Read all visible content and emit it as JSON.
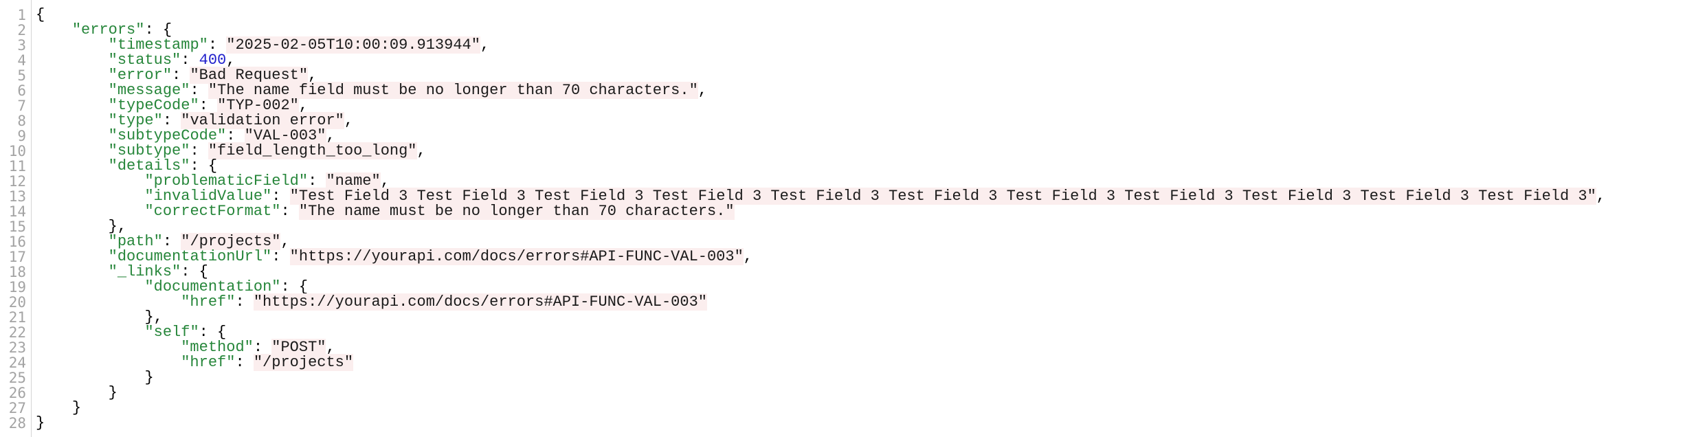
{
  "json_viewer": {
    "colors": {
      "key": "#26863a",
      "string_text": "#1a1a1a",
      "string_bg": "#fbeeee",
      "number": "#1f1fcc",
      "punct": "#000000",
      "line_number": "#a3a3a3"
    },
    "lines": [
      {
        "tokens": [
          {
            "t": "p",
            "v": "{"
          }
        ]
      },
      {
        "tokens": [
          {
            "t": "i",
            "v": "    "
          },
          {
            "t": "k",
            "v": "\"errors\""
          },
          {
            "t": "p",
            "v": ": {"
          }
        ]
      },
      {
        "tokens": [
          {
            "t": "i",
            "v": "        "
          },
          {
            "t": "k",
            "v": "\"timestamp\""
          },
          {
            "t": "p",
            "v": ": "
          },
          {
            "t": "s",
            "v": "\"2025-02-05T10:00:09.913944\""
          },
          {
            "t": "p",
            "v": ","
          }
        ]
      },
      {
        "tokens": [
          {
            "t": "i",
            "v": "        "
          },
          {
            "t": "k",
            "v": "\"status\""
          },
          {
            "t": "p",
            "v": ": "
          },
          {
            "t": "n",
            "v": "400"
          },
          {
            "t": "p",
            "v": ","
          }
        ]
      },
      {
        "tokens": [
          {
            "t": "i",
            "v": "        "
          },
          {
            "t": "k",
            "v": "\"error\""
          },
          {
            "t": "p",
            "v": ": "
          },
          {
            "t": "s",
            "v": "\"Bad Request\""
          },
          {
            "t": "p",
            "v": ","
          }
        ]
      },
      {
        "tokens": [
          {
            "t": "i",
            "v": "        "
          },
          {
            "t": "k",
            "v": "\"message\""
          },
          {
            "t": "p",
            "v": ": "
          },
          {
            "t": "s",
            "v": "\"The name field must be no longer than 70 characters.\""
          },
          {
            "t": "p",
            "v": ","
          }
        ]
      },
      {
        "tokens": [
          {
            "t": "i",
            "v": "        "
          },
          {
            "t": "k",
            "v": "\"typeCode\""
          },
          {
            "t": "p",
            "v": ": "
          },
          {
            "t": "s",
            "v": "\"TYP-002\""
          },
          {
            "t": "p",
            "v": ","
          }
        ]
      },
      {
        "tokens": [
          {
            "t": "i",
            "v": "        "
          },
          {
            "t": "k",
            "v": "\"type\""
          },
          {
            "t": "p",
            "v": ": "
          },
          {
            "t": "s",
            "v": "\"validation error\""
          },
          {
            "t": "p",
            "v": ","
          }
        ]
      },
      {
        "tokens": [
          {
            "t": "i",
            "v": "        "
          },
          {
            "t": "k",
            "v": "\"subtypeCode\""
          },
          {
            "t": "p",
            "v": ": "
          },
          {
            "t": "s",
            "v": "\"VAL-003\""
          },
          {
            "t": "p",
            "v": ","
          }
        ]
      },
      {
        "tokens": [
          {
            "t": "i",
            "v": "        "
          },
          {
            "t": "k",
            "v": "\"subtype\""
          },
          {
            "t": "p",
            "v": ": "
          },
          {
            "t": "s",
            "v": "\"field_length_too_long\""
          },
          {
            "t": "p",
            "v": ","
          }
        ]
      },
      {
        "tokens": [
          {
            "t": "i",
            "v": "        "
          },
          {
            "t": "k",
            "v": "\"details\""
          },
          {
            "t": "p",
            "v": ": {"
          }
        ]
      },
      {
        "tokens": [
          {
            "t": "i",
            "v": "            "
          },
          {
            "t": "k",
            "v": "\"problematicField\""
          },
          {
            "t": "p",
            "v": ": "
          },
          {
            "t": "s",
            "v": "\"name\""
          },
          {
            "t": "p",
            "v": ","
          }
        ]
      },
      {
        "tokens": [
          {
            "t": "i",
            "v": "            "
          },
          {
            "t": "k",
            "v": "\"invalidValue\""
          },
          {
            "t": "p",
            "v": ": "
          },
          {
            "t": "s",
            "v": "\"Test Field 3 Test Field 3 Test Field 3 Test Field 3 Test Field 3 Test Field 3 Test Field 3 Test Field 3 Test Field 3 Test Field 3 Test Field 3\""
          },
          {
            "t": "p",
            "v": ","
          }
        ]
      },
      {
        "tokens": [
          {
            "t": "i",
            "v": "            "
          },
          {
            "t": "k",
            "v": "\"correctFormat\""
          },
          {
            "t": "p",
            "v": ": "
          },
          {
            "t": "s",
            "v": "\"The name must be no longer than 70 characters.\""
          }
        ]
      },
      {
        "tokens": [
          {
            "t": "i",
            "v": "        "
          },
          {
            "t": "p",
            "v": "},"
          }
        ]
      },
      {
        "tokens": [
          {
            "t": "i",
            "v": "        "
          },
          {
            "t": "k",
            "v": "\"path\""
          },
          {
            "t": "p",
            "v": ": "
          },
          {
            "t": "s",
            "v": "\"/projects\""
          },
          {
            "t": "p",
            "v": ","
          }
        ]
      },
      {
        "tokens": [
          {
            "t": "i",
            "v": "        "
          },
          {
            "t": "k",
            "v": "\"documentationUrl\""
          },
          {
            "t": "p",
            "v": ": "
          },
          {
            "t": "s",
            "v": "\"https://yourapi.com/docs/errors#API-FUNC-VAL-003\""
          },
          {
            "t": "p",
            "v": ","
          }
        ]
      },
      {
        "tokens": [
          {
            "t": "i",
            "v": "        "
          },
          {
            "t": "k",
            "v": "\"_links\""
          },
          {
            "t": "p",
            "v": ": {"
          }
        ]
      },
      {
        "tokens": [
          {
            "t": "i",
            "v": "            "
          },
          {
            "t": "k",
            "v": "\"documentation\""
          },
          {
            "t": "p",
            "v": ": {"
          }
        ]
      },
      {
        "tokens": [
          {
            "t": "i",
            "v": "                "
          },
          {
            "t": "k",
            "v": "\"href\""
          },
          {
            "t": "p",
            "v": ": "
          },
          {
            "t": "s",
            "v": "\"https://yourapi.com/docs/errors#API-FUNC-VAL-003\""
          }
        ]
      },
      {
        "tokens": [
          {
            "t": "i",
            "v": "            "
          },
          {
            "t": "p",
            "v": "},"
          }
        ]
      },
      {
        "tokens": [
          {
            "t": "i",
            "v": "            "
          },
          {
            "t": "k",
            "v": "\"self\""
          },
          {
            "t": "p",
            "v": ": {"
          }
        ]
      },
      {
        "tokens": [
          {
            "t": "i",
            "v": "                "
          },
          {
            "t": "k",
            "v": "\"method\""
          },
          {
            "t": "p",
            "v": ": "
          },
          {
            "t": "s",
            "v": "\"POST\""
          },
          {
            "t": "p",
            "v": ","
          }
        ]
      },
      {
        "tokens": [
          {
            "t": "i",
            "v": "                "
          },
          {
            "t": "k",
            "v": "\"href\""
          },
          {
            "t": "p",
            "v": ": "
          },
          {
            "t": "s",
            "v": "\"/projects\""
          }
        ]
      },
      {
        "tokens": [
          {
            "t": "i",
            "v": "            "
          },
          {
            "t": "p",
            "v": "}"
          }
        ]
      },
      {
        "tokens": [
          {
            "t": "i",
            "v": "        "
          },
          {
            "t": "p",
            "v": "}"
          }
        ]
      },
      {
        "tokens": [
          {
            "t": "i",
            "v": "    "
          },
          {
            "t": "p",
            "v": "}"
          }
        ]
      },
      {
        "tokens": [
          {
            "t": "p",
            "v": "}"
          }
        ]
      }
    ]
  }
}
